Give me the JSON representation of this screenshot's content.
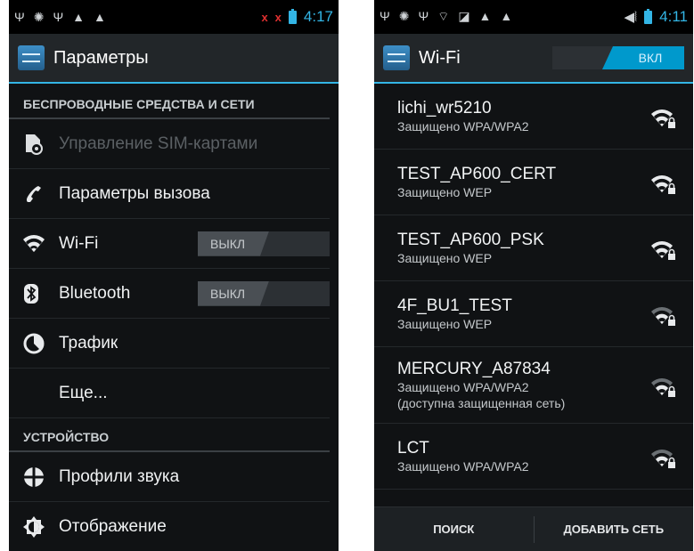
{
  "left": {
    "status_time": "4:17",
    "status_x1": "x",
    "status_x2": "x",
    "title": "Параметры",
    "section_wireless": "БЕСПРОВОДНЫЕ СРЕДСТВА И СЕТИ",
    "sim_label": "Управление SIM-картами",
    "call_label": "Параметры вызова",
    "wifi_label": "Wi-Fi",
    "wifi_toggle": "ВЫКЛ",
    "bt_label": "Bluetooth",
    "bt_toggle": "ВЫКЛ",
    "traffic_label": "Трафик",
    "more_label": "Еще...",
    "section_device": "УСТРОЙСТВО",
    "sound_label": "Профили звука",
    "display_label": "Отображение"
  },
  "right": {
    "status_time": "4:11",
    "title": "Wi-Fi",
    "toggle": "ВКЛ",
    "networks": [
      {
        "name": "lichi_wr5210",
        "security": "Защищено WPA/WPA2",
        "extra": ""
      },
      {
        "name": "TEST_AP600_CERT",
        "security": "Защищено WEP",
        "extra": ""
      },
      {
        "name": "TEST_AP600_PSK",
        "security": "Защищено WEP",
        "extra": ""
      },
      {
        "name": "4F_BU1_TEST",
        "security": "Защищено WEP",
        "extra": ""
      },
      {
        "name": "MERCURY_A87834",
        "security": "Защищено WPA/WPA2",
        "extra": "(доступна защищенная сеть)"
      },
      {
        "name": "LCT",
        "security": "Защищено WPA/WPA2",
        "extra": ""
      }
    ],
    "search_button": "ПОИСК",
    "add_network_button": "ДОБАВИТЬ СЕТЬ"
  },
  "colors": {
    "accent": "#33b5e5",
    "toggle_on": "#0099cc",
    "background": "#101214"
  },
  "icons": [
    "usb-icon",
    "android-debug-icon",
    "warning-icon",
    "sim-missing-icon",
    "battery-icon",
    "sim-card-icon",
    "phone-icon",
    "wifi-icon",
    "bluetooth-icon",
    "data-usage-icon",
    "sound-icon",
    "display-icon",
    "wifi-lock-icon",
    "volume-muted-icon"
  ]
}
